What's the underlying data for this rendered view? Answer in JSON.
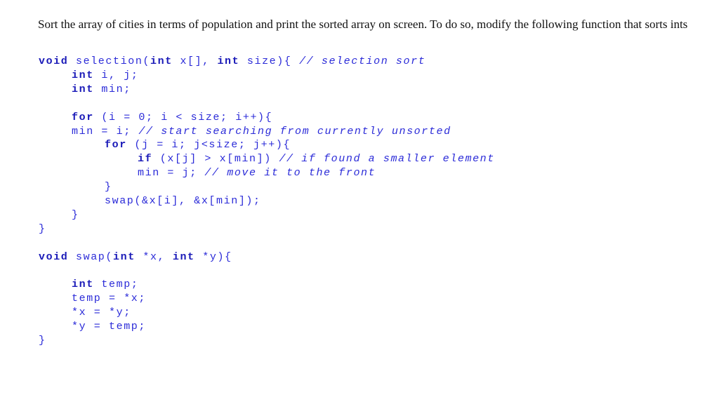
{
  "prompt": {
    "text": "Sort the array of cities in terms of population and print the sorted array on screen. To do so, modify the following function that sorts ints"
  },
  "colors": {
    "code_text": "#2b2bd8",
    "keyword": "#1a1ab8",
    "prose_text": "#111111",
    "background": "#ffffff"
  },
  "code": {
    "lines": [
      {
        "indent": 0,
        "segments": [
          {
            "t": "kw",
            "v": "void"
          },
          {
            "t": "tx",
            "v": " selection("
          },
          {
            "t": "kw",
            "v": "int"
          },
          {
            "t": "tx",
            "v": " x[], "
          },
          {
            "t": "kw",
            "v": "int"
          },
          {
            "t": "tx",
            "v": " size){ "
          },
          {
            "t": "cm",
            "v": "// selection sort"
          }
        ]
      },
      {
        "indent": 1,
        "segments": [
          {
            "t": "kw",
            "v": "int"
          },
          {
            "t": "tx",
            "v": " i, j;"
          }
        ]
      },
      {
        "indent": 1,
        "segments": [
          {
            "t": "kw",
            "v": "int"
          },
          {
            "t": "tx",
            "v": " min;"
          }
        ]
      },
      {
        "indent": 0,
        "segments": []
      },
      {
        "indent": 1,
        "segments": [
          {
            "t": "kw",
            "v": "for"
          },
          {
            "t": "tx",
            "v": " (i = 0; i < size; i++){"
          }
        ]
      },
      {
        "indent": 1,
        "segments": [
          {
            "t": "tx",
            "v": "min = i; "
          },
          {
            "t": "cm",
            "v": "// start searching from currently unsorted"
          }
        ]
      },
      {
        "indent": 2,
        "segments": [
          {
            "t": "kw",
            "v": "for"
          },
          {
            "t": "tx",
            "v": " (j = i; j<size; j++){"
          }
        ]
      },
      {
        "indent": 3,
        "segments": [
          {
            "t": "kw",
            "v": "if"
          },
          {
            "t": "tx",
            "v": " (x[j] > x[min]) "
          },
          {
            "t": "cm",
            "v": "// if found a smaller element"
          }
        ]
      },
      {
        "indent": 3,
        "segments": [
          {
            "t": "tx",
            "v": "min = j; "
          },
          {
            "t": "cm",
            "v": "// move it to the front"
          }
        ]
      },
      {
        "indent": 2,
        "segments": [
          {
            "t": "tx",
            "v": "}"
          }
        ]
      },
      {
        "indent": 2,
        "segments": [
          {
            "t": "tx",
            "v": "swap(&x[i], &x[min]);"
          }
        ]
      },
      {
        "indent": 1,
        "segments": [
          {
            "t": "tx",
            "v": "}"
          }
        ]
      },
      {
        "indent": 0,
        "segments": [
          {
            "t": "tx",
            "v": "}"
          }
        ]
      },
      {
        "indent": 0,
        "segments": []
      },
      {
        "indent": 0,
        "segments": [
          {
            "t": "kw",
            "v": "void"
          },
          {
            "t": "tx",
            "v": " swap("
          },
          {
            "t": "kw",
            "v": "int"
          },
          {
            "t": "tx",
            "v": " *x, "
          },
          {
            "t": "kw",
            "v": "int"
          },
          {
            "t": "tx",
            "v": " *y){"
          }
        ]
      },
      {
        "indent": 0,
        "segments": []
      },
      {
        "indent": 1,
        "segments": [
          {
            "t": "kw",
            "v": "int"
          },
          {
            "t": "tx",
            "v": " temp;"
          }
        ]
      },
      {
        "indent": 1,
        "segments": [
          {
            "t": "tx",
            "v": "temp = *x;"
          }
        ]
      },
      {
        "indent": 1,
        "segments": [
          {
            "t": "tx",
            "v": "*x = *y;"
          }
        ]
      },
      {
        "indent": 1,
        "segments": [
          {
            "t": "tx",
            "v": "*y = temp;"
          }
        ]
      },
      {
        "indent": 0,
        "segments": [
          {
            "t": "tx",
            "v": "}"
          }
        ]
      }
    ]
  }
}
